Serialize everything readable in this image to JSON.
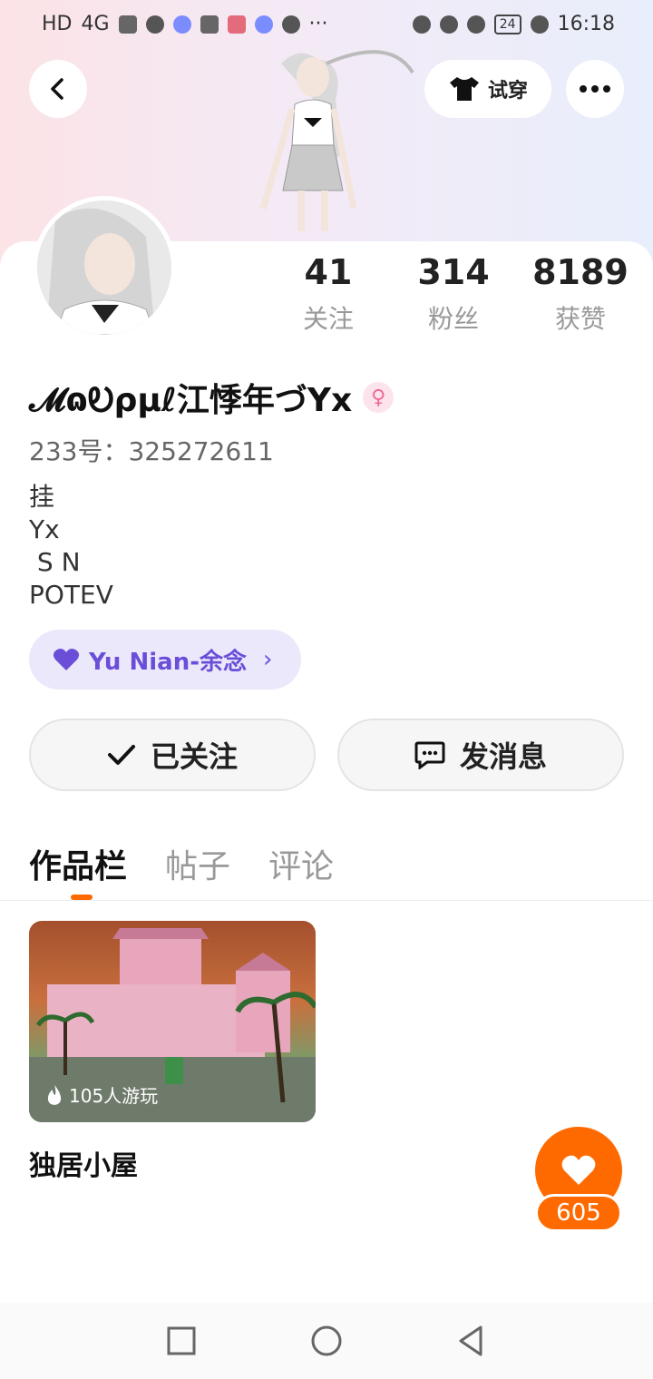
{
  "status_bar": {
    "left_text": [
      "HD",
      "4G"
    ],
    "battery": "24",
    "time": "16:18"
  },
  "header": {
    "back_icon": "back-icon",
    "try_on_label": "试穿",
    "try_on_icon": "tshirt-icon",
    "more_icon": "more-icon"
  },
  "stats": [
    {
      "value": "41",
      "label": "关注"
    },
    {
      "value": "314",
      "label": "粉丝"
    },
    {
      "value": "8189",
      "label": "获赞"
    }
  ],
  "profile": {
    "username": "𝓜ɷᎧρμℓ江悸年づYx",
    "gender_icon": "female-icon",
    "uid": "233号：325272611",
    "bio": "挂\nYx\n S N\nPOTEV"
  },
  "guild": {
    "label": "Yu Nian-余念",
    "icon": "heart-icon"
  },
  "actions": {
    "follow_label": "已关注",
    "message_label": "发消息"
  },
  "tabs": [
    {
      "label": "作品栏",
      "active": true
    },
    {
      "label": "帖子",
      "active": false
    },
    {
      "label": "评论",
      "active": false
    }
  ],
  "works": [
    {
      "title": "独居小屋",
      "plays": "105人游玩"
    }
  ],
  "like_fab": {
    "count": "605",
    "icon": "heart-icon"
  },
  "colors": {
    "accent": "#ff6a00",
    "guild_bg": "#ebe8fb",
    "guild_text": "#6b4ed8"
  }
}
